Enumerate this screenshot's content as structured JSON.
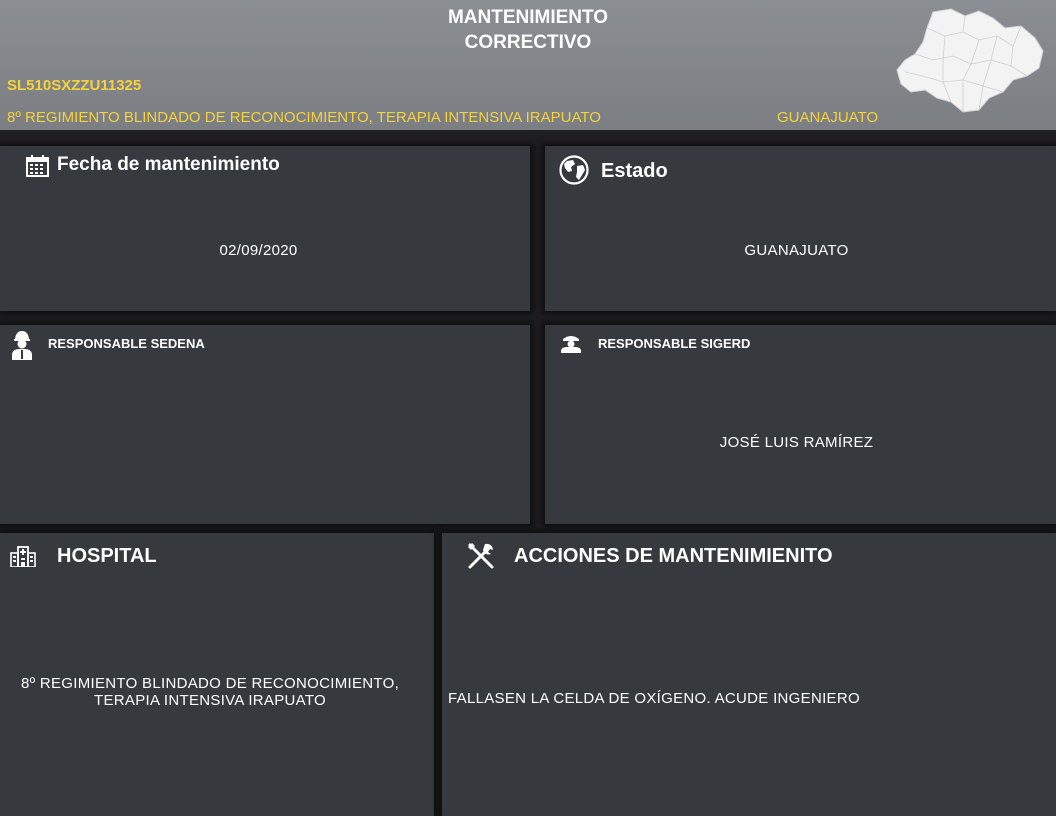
{
  "header": {
    "title_line1": "MANTENIMIENTO",
    "title_line2": "CORRECTIVO",
    "serial": "SL510SXZZU11325",
    "hospital": "8º REGIMIENTO BLINDADO DE RECONOCIMIENTO, TERAPIA INTENSIVA IRAPUATO",
    "state": "GUANAJUATO",
    "map_icon": "guanajuato-map-icon"
  },
  "cards": {
    "fecha": {
      "title": "Fecha de mantenimiento",
      "value": "02/09/2020",
      "icon": "calendar-icon"
    },
    "estado": {
      "title": "Estado",
      "value": "GUANAJUATO",
      "icon": "globe-icon"
    },
    "sedena": {
      "title": "RESPONSABLE SEDENA",
      "value": "",
      "icon": "soldier-icon"
    },
    "sigerd": {
      "title": "RESPONSABLE SIGERD",
      "value": "JOSÉ LUIS RAMÍREZ",
      "icon": "officer-icon"
    },
    "hospital": {
      "title": "HOSPITAL",
      "value_line1": "8º REGIMIENTO BLINDADO DE RECONOCIMIENTO,",
      "value_line2": "TERAPIA INTENSIVA IRAPUATO",
      "icon": "hospital-icon"
    },
    "acciones": {
      "title": "ACCIONES DE MANTENIMIENITO",
      "value": "FALLASEN LA CELDA DE OXÍGENO.  ACUDE INGENIERO",
      "icon": "tools-icon"
    }
  },
  "colors": {
    "header_bg": "#84878b",
    "accent_yellow": "#f6d23a",
    "card_bg": "#363a3e",
    "page_bg": "#1f1e20"
  }
}
